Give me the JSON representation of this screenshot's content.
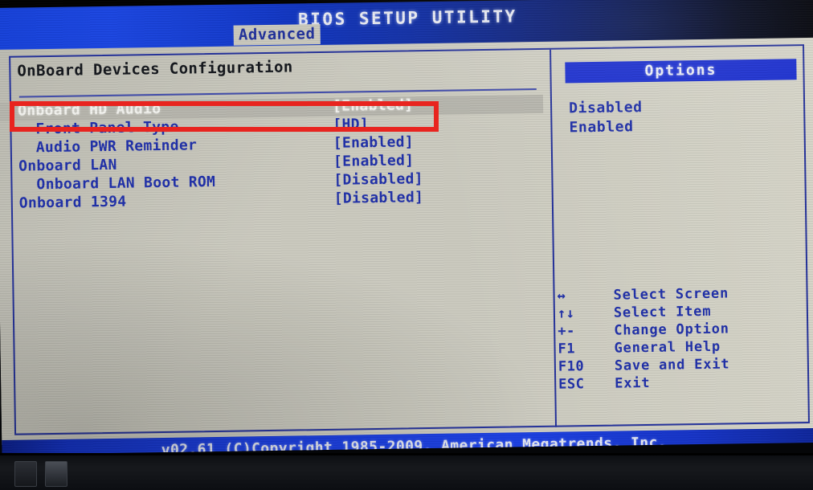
{
  "header": {
    "title": "BIOS SETUP UTILITY",
    "active_tab": "Advanced"
  },
  "main": {
    "section_title": "OnBoard Devices Configuration",
    "settings": [
      {
        "label": "Onboard HD Audio",
        "value": "[Enabled]",
        "indent": false,
        "selected": true
      },
      {
        "label": "Front Panel Type",
        "value": "[HD]",
        "indent": true,
        "selected": false
      },
      {
        "label": "Audio PWR Reminder",
        "value": "[Enabled]",
        "indent": true,
        "selected": false
      },
      {
        "label": "Onboard LAN",
        "value": "[Enabled]",
        "indent": false,
        "selected": false
      },
      {
        "label": "Onboard LAN Boot ROM",
        "value": "[Disabled]",
        "indent": true,
        "selected": false
      },
      {
        "label": "Onboard 1394",
        "value": "[Disabled]",
        "indent": false,
        "selected": false
      }
    ]
  },
  "options": {
    "header": "Options",
    "items": [
      "Disabled",
      "Enabled"
    ]
  },
  "legend": {
    "rows": [
      {
        "key": "↔",
        "desc": "Select Screen",
        "icon": "left-right-arrow-icon"
      },
      {
        "key": "↑↓",
        "desc": "Select Item",
        "icon": "up-down-arrow-icon"
      },
      {
        "key": "+-",
        "desc": "Change Option",
        "icon": "plus-minus-icon"
      },
      {
        "key": "F1",
        "desc": "General Help",
        "icon": "f1-key-icon"
      },
      {
        "key": "F10",
        "desc": "Save and Exit",
        "icon": "f10-key-icon"
      },
      {
        "key": "ESC",
        "desc": "Exit",
        "icon": "esc-key-icon"
      }
    ]
  },
  "footer": {
    "text": "v02.61 (C)Copyright 1985-2009, American Megatrends, Inc."
  },
  "colors": {
    "screen_background": "#cbcabf",
    "text_blue": "#1f2fa8",
    "panel_border": "#23309a",
    "header_blue": "#1a3ee0",
    "options_header_blue": "#1a2ecf",
    "selected_row_background": "#b6b5ac",
    "selected_row_text": "#f2f2ee",
    "annotation_red": "#e8241f",
    "tab_background": "#c9c8bd"
  }
}
